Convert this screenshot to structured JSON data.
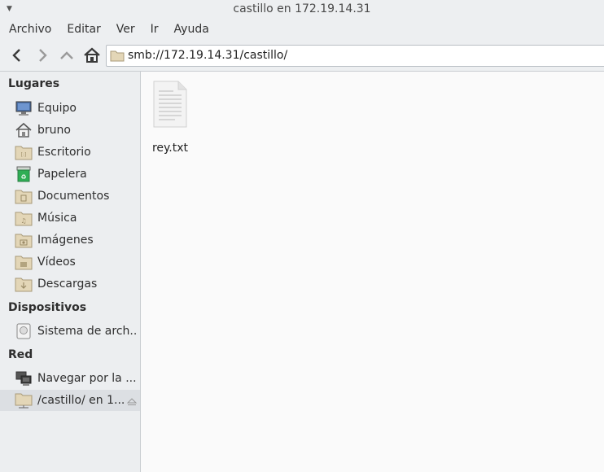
{
  "window": {
    "title": "castillo en 172.19.14.31"
  },
  "menubar": {
    "items": [
      "Archivo",
      "Editar",
      "Ver",
      "Ir",
      "Ayuda"
    ]
  },
  "toolbar": {
    "location": "smb://172.19.14.31/castillo/",
    "icons": [
      "back-icon",
      "forward-icon",
      "up-icon",
      "home-icon"
    ]
  },
  "sidebar": {
    "places_header": "Lugares",
    "places": [
      {
        "label": "Equipo",
        "icon": "computer-icon"
      },
      {
        "label": "bruno",
        "icon": "home-icon"
      },
      {
        "label": "Escritorio",
        "icon": "desktop-folder-icon"
      },
      {
        "label": "Papelera",
        "icon": "trash-icon"
      },
      {
        "label": "Documentos",
        "icon": "documents-folder-icon"
      },
      {
        "label": "Música",
        "icon": "music-folder-icon"
      },
      {
        "label": "Imágenes",
        "icon": "pictures-folder-icon"
      },
      {
        "label": "Vídeos",
        "icon": "videos-folder-icon"
      },
      {
        "label": "Descargas",
        "icon": "downloads-folder-icon"
      }
    ],
    "devices_header": "Dispositivos",
    "devices": [
      {
        "label": "Sistema de arch...",
        "icon": "drive-icon"
      }
    ],
    "network_header": "Red",
    "network": [
      {
        "label": "Navegar por la ...",
        "icon": "network-icon"
      },
      {
        "label": "/castillo/ en 1...",
        "icon": "network-folder-icon",
        "selected": true
      }
    ]
  },
  "content": {
    "files": [
      {
        "name": "rey.txt",
        "icon": "text-file-icon"
      }
    ]
  },
  "colors": {
    "sidebar_bg": "#eceef0",
    "content_bg": "#fafafa",
    "folder": "#d8c9a6",
    "selection": "#dcdfe3"
  }
}
